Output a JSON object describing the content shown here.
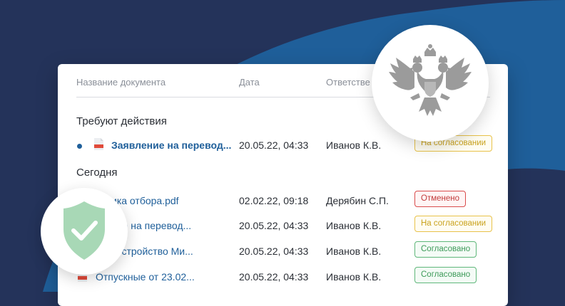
{
  "table": {
    "columns": {
      "name": "Название документа",
      "date": "Дата",
      "owner": "Ответстве"
    },
    "sections": {
      "action_required": "Требуют действия",
      "today": "Сегодня"
    },
    "rows": [
      {
        "name": "Заявление на перевод...",
        "date": "20.05.22, 04:33",
        "owner": "Иванов К.В.",
        "status": "На согласовании",
        "unread": true
      },
      {
        "name": "ика отбора.pdf",
        "date": "02.02.22, 09:18",
        "owner": "Дерябин С.П.",
        "status": "Отменено"
      },
      {
        "name": "ние на перевод...",
        "date": "20.05.22, 04:33",
        "owner": "Иванов К.В.",
        "status": "На согласовании"
      },
      {
        "name": "оустройство Ми...",
        "date": "20.05.22, 04:33",
        "owner": "Иванов К.В.",
        "status": "Согласовано"
      },
      {
        "name": "Отпускные от 23.02...",
        "date": "20.05.22, 04:33",
        "owner": "Иванов К.В.",
        "status": "Согласовано"
      }
    ]
  },
  "icons": {
    "file": "pdf-file-icon",
    "emblem": "coat-of-arms-icon",
    "security": "shield-check-icon"
  },
  "colors": {
    "background": "#24335a",
    "wave": "#1f5f9a",
    "link": "#1f5f9a",
    "pending": "#e8c24a",
    "cancelled": "#d94b4b",
    "approved": "#5fb77a",
    "shield": "#a8d8b6"
  }
}
